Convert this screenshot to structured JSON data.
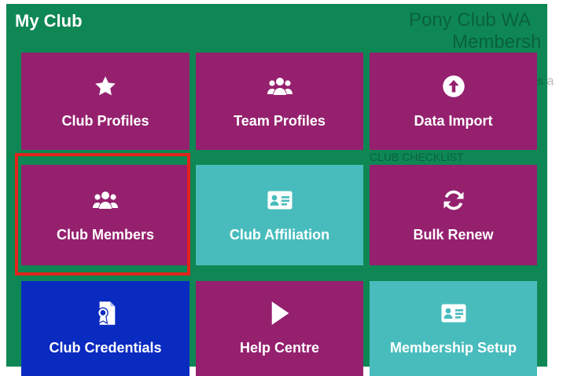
{
  "panel": {
    "title": "My Club",
    "background_color": "#0e8754",
    "ghost_text": {
      "line1": "Pony Club WA",
      "line2": "Membersh",
      "line3": "s a",
      "line4": "CLUB CHECKLIST"
    }
  },
  "tiles": [
    {
      "label": "Club Profiles",
      "icon": "star-icon",
      "color": "#95206e"
    },
    {
      "label": "Team Profiles",
      "icon": "users-icon",
      "color": "#95206e"
    },
    {
      "label": "Data Import",
      "icon": "upload-circle-icon",
      "color": "#95206e"
    },
    {
      "label": "Club Members",
      "icon": "users-icon",
      "color": "#95206e",
      "highlighted": true
    },
    {
      "label": "Club Affiliation",
      "icon": "id-card-icon",
      "color": "#48bcbc"
    },
    {
      "label": "Bulk Renew",
      "icon": "refresh-icon",
      "color": "#95206e"
    },
    {
      "label": "Club Credentials",
      "icon": "certificate-icon",
      "color": "#0a2bc0"
    },
    {
      "label": "Help Centre",
      "icon": "play-icon",
      "color": "#95206e"
    },
    {
      "label": "Membership Setup",
      "icon": "id-card-icon",
      "color": "#48bcbc"
    }
  ],
  "highlight_color": "#e3241b"
}
